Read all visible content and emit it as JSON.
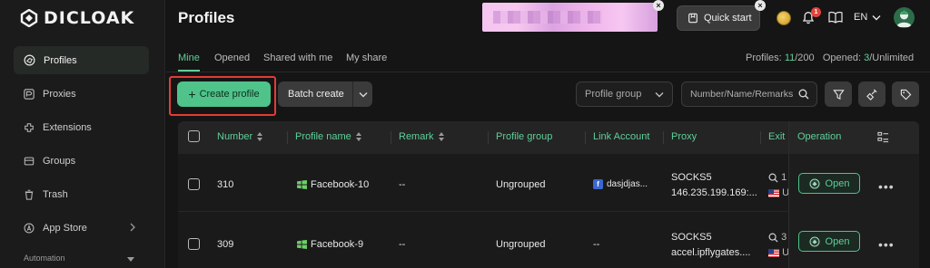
{
  "app": {
    "brand": "DICLOAK",
    "page_title": "Profiles"
  },
  "sidebar": {
    "items": [
      {
        "label": "Profiles",
        "icon": "globe-icon",
        "active": true
      },
      {
        "label": "Proxies",
        "icon": "proxy-icon"
      },
      {
        "label": "Extensions",
        "icon": "extensions-icon"
      },
      {
        "label": "Groups",
        "icon": "folder-icon"
      },
      {
        "label": "Trash",
        "icon": "trash-icon"
      },
      {
        "label": "App Store",
        "icon": "app-store-icon"
      }
    ],
    "section_label": "Automation"
  },
  "header": {
    "quick_start_label": "Quick start",
    "notification_count": "1",
    "language": "EN"
  },
  "tabs": [
    {
      "label": "Mine",
      "active": true
    },
    {
      "label": "Opened"
    },
    {
      "label": "Shared with me"
    },
    {
      "label": "My share"
    }
  ],
  "stats": {
    "profiles_label": "Profiles:",
    "profiles_used": "11",
    "profiles_total": "/200",
    "opened_label": "Opened:",
    "opened_used": "3",
    "opened_total": "/Unlimited"
  },
  "toolbar": {
    "create_label": "Create profile",
    "batch_label": "Batch create",
    "group_select_placeholder": "Profile group",
    "search_placeholder": "Number/Name/Remarks"
  },
  "table": {
    "columns": {
      "number": "Number",
      "profile_name": "Profile name",
      "remark": "Remark",
      "profile_group": "Profile group",
      "link_account": "Link Account",
      "proxy": "Proxy",
      "exit": "Exit",
      "operation": "Operation"
    },
    "rows": [
      {
        "number": "310",
        "profile_name": "Facebook-10",
        "remark": "--",
        "group": "Ungrouped",
        "link_account": "dasjdjas...",
        "proxy_type": "SOCKS5",
        "proxy_host": "146.235.199.169:...",
        "exit_top": "1",
        "exit_bottom": "U",
        "open_label": "Open"
      },
      {
        "number": "309",
        "profile_name": "Facebook-9",
        "remark": "--",
        "group": "Ungrouped",
        "link_account": "--",
        "proxy_type": "SOCKS5",
        "proxy_host": "accel.ipflygates....",
        "exit_top": "3",
        "exit_bottom": "U",
        "open_label": "Open"
      }
    ]
  },
  "colors": {
    "accent": "#5fd09a",
    "button": "#4fc38a",
    "highlight_frame": "#e33b36"
  }
}
